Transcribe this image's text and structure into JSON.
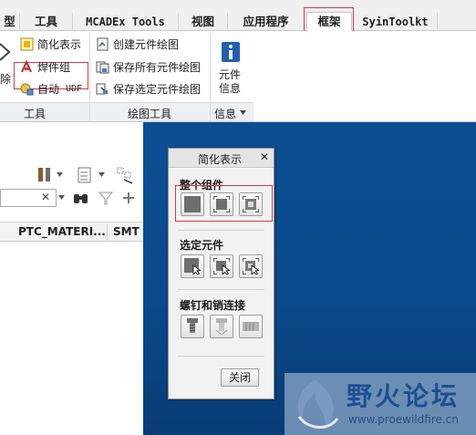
{
  "tabs": [
    {
      "label": "型"
    },
    {
      "label": "工具"
    },
    {
      "label": "MCADEx Tools"
    },
    {
      "label": "视图"
    },
    {
      "label": "应用程序"
    },
    {
      "label": "框架",
      "active": true
    },
    {
      "label": "SyinToolkt"
    }
  ],
  "ribbon": {
    "partial_label": "除",
    "tools_group": {
      "buttons": [
        {
          "label": "简化表示",
          "icon": "simplified-rep-icon"
        },
        {
          "label": "焊件组",
          "icon": "weld-group-icon"
        },
        {
          "label": "自动",
          "suffix": "UDF",
          "icon": "auto-udf-icon"
        }
      ],
      "group_label": "工具"
    },
    "drawing_group": {
      "buttons": [
        {
          "label": "创建元件绘图",
          "icon": "create-drawing-icon"
        },
        {
          "label": "保存所有元件绘图",
          "icon": "save-all-drawings-icon"
        },
        {
          "label": "保存选定元件绘图",
          "icon": "save-selected-drawings-icon"
        }
      ],
      "group_label": "绘图工具"
    },
    "info_group": {
      "button": {
        "label_line1": "元件",
        "label_line2": "信息",
        "icon": "info-icon"
      },
      "group_label": "信息"
    }
  },
  "model_tree": {
    "search_clear": "✕",
    "columns": [
      "PTC_MATERI...",
      "SMT"
    ]
  },
  "dialog": {
    "title": "简化表示",
    "close_x": "✕",
    "sections": [
      {
        "label": "整个组件"
      },
      {
        "label": "选定元件"
      },
      {
        "label": "螺钉和销连接"
      }
    ],
    "close_label": "关闭"
  },
  "watermark": {
    "title": "野火论坛",
    "url": "www.proewildfire.cn"
  },
  "colors": {
    "highlight_red": "#d9383c",
    "viewport_blue": "#0a4a8c",
    "info_blue": "#1f5fae"
  }
}
